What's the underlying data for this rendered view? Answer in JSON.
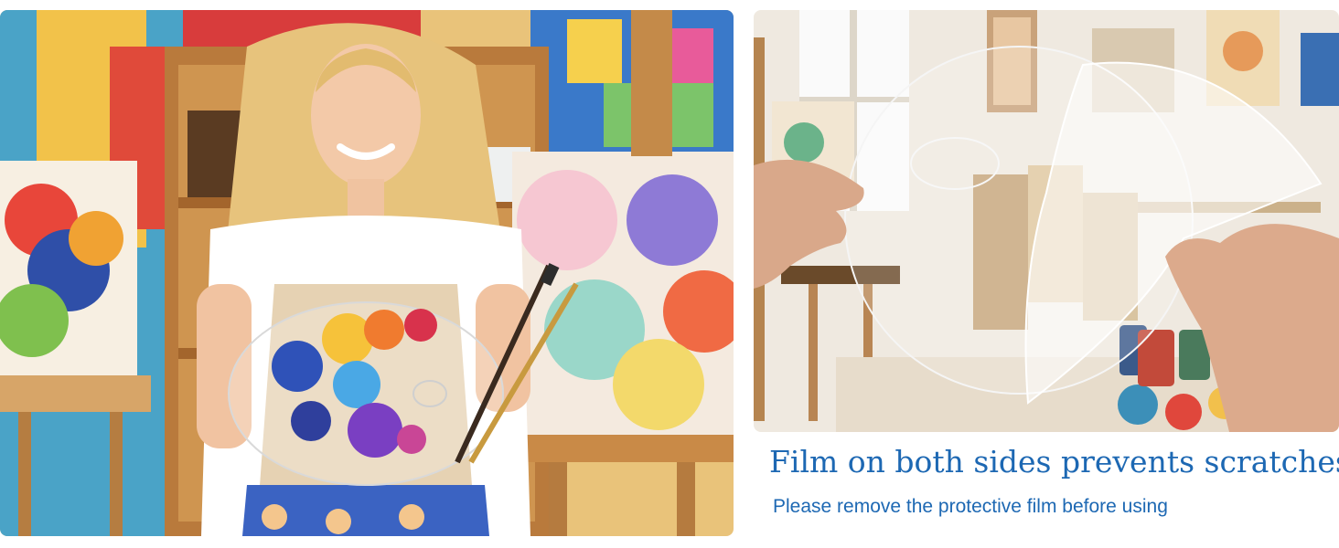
{
  "caption": {
    "headline": "Film on both sides prevents scratches",
    "subline": "Please remove the protective film before using"
  },
  "colors": {
    "caption_blue": "#1d68b3",
    "background": "#ffffff"
  }
}
